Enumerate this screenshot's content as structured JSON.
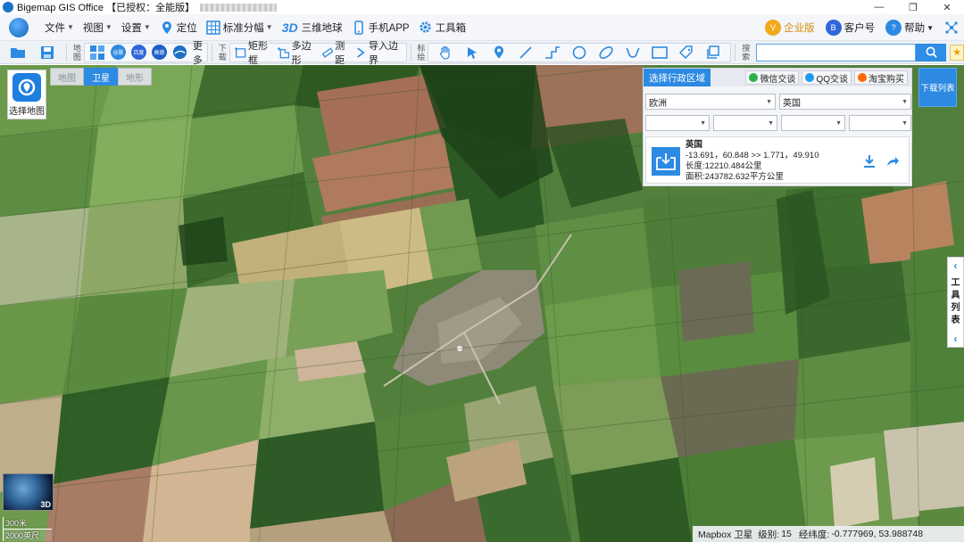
{
  "window": {
    "title": "Bigemap GIS Office 【已授权：全能版】",
    "controls": [
      "—",
      "❐",
      "✕"
    ]
  },
  "menubar": {
    "file": "文件",
    "view": "视图",
    "settings": "设置",
    "locate": "定位",
    "standard_sheet": "标准分幅",
    "three_d_label": "3D",
    "three_d_globe": "三维地球",
    "mobile_app": "手机APP",
    "toolbox": "工具箱",
    "enterprise": "企业版",
    "client_account": "客户号",
    "help": "帮助"
  },
  "toolbar": {
    "map_group_label": "地图",
    "more": "更多",
    "download_group_label": "下载",
    "rectangle": "矩形框",
    "polygon": "多边形",
    "measure": "测距",
    "import_boundary": "导入边界",
    "mark_group_label": "标绘",
    "search_group_label": "搜索",
    "search_placeholder": "",
    "layer_badges": [
      "谷歌",
      "百度",
      "高德"
    ]
  },
  "map_switch": {
    "select_map": "选择地图",
    "tabs": [
      {
        "label": "地图",
        "active": false
      },
      {
        "label": "卫星",
        "active": true
      },
      {
        "label": "地形",
        "active": false
      }
    ]
  },
  "admin_panel": {
    "title": "选择行政区域",
    "share": [
      {
        "label": "微信交谈",
        "color": "#2bb24c"
      },
      {
        "label": "QQ交谈",
        "color": "#1d9bf0"
      },
      {
        "label": "淘宝购买",
        "color": "#ff6a00"
      }
    ],
    "continent": "欧洲",
    "country": "英国",
    "empty_selects": [
      "",
      "",
      "",
      ""
    ],
    "result": {
      "name": "英国",
      "bounds": "-13.691，60.848 >> 1.771，49.910",
      "length": "长度:12210.484公里",
      "area": "面积:243782.632平方公里"
    }
  },
  "download_list": "下载列表",
  "tool_list": {
    "label": [
      "工",
      "具",
      "列",
      "表"
    ]
  },
  "overview": {
    "label": "3D"
  },
  "scale": {
    "meters": "300米",
    "feet": "2000英尺"
  },
  "status_bar": {
    "source": "Mapbox 卫星",
    "level_label": "级别:",
    "level": "15",
    "coord_label": "经纬度:",
    "coords": "-0.777969, 53.988748"
  },
  "colors": {
    "accent": "#2d8ae2",
    "toolbar_bg": "#eef1f6"
  }
}
